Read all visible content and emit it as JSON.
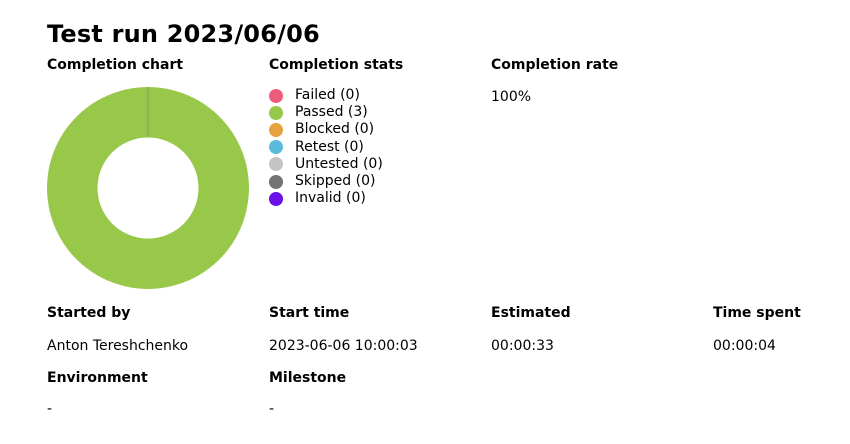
{
  "page": {
    "title": "Test run 2023/06/06"
  },
  "completion_chart": {
    "heading": "Completion chart"
  },
  "completion_stats": {
    "heading": "Completion stats",
    "items": [
      {
        "label": "Failed (0)",
        "color": "#ef5b7a",
        "count": 0
      },
      {
        "label": "Passed (3)",
        "color": "#98c84a",
        "count": 3
      },
      {
        "label": "Blocked (0)",
        "color": "#e6a23c",
        "count": 0
      },
      {
        "label": "Retest (0)",
        "color": "#5bbbdc",
        "count": 0
      },
      {
        "label": "Untested (0)",
        "color": "#c4c4c4",
        "count": 0
      },
      {
        "label": "Skipped (0)",
        "color": "#747474",
        "count": 0
      },
      {
        "label": "Invalid (0)",
        "color": "#6a10e8",
        "count": 0
      }
    ]
  },
  "completion_rate": {
    "heading": "Completion rate",
    "value": "100%"
  },
  "details": {
    "started_by": {
      "label": "Started by",
      "value": "Anton Tereshchenko"
    },
    "start_time": {
      "label": "Start time",
      "value": "2023-06-06 10:00:03"
    },
    "estimated": {
      "label": "Estimated",
      "value": "00:00:33"
    },
    "time_spent": {
      "label": "Time spent",
      "value": "00:00:04"
    },
    "environment": {
      "label": "Environment",
      "value": "-"
    },
    "milestone": {
      "label": "Milestone",
      "value": "-"
    }
  },
  "chart_data": {
    "type": "pie",
    "categories": [
      "Failed",
      "Passed",
      "Blocked",
      "Retest",
      "Untested",
      "Skipped",
      "Invalid"
    ],
    "values": [
      0,
      3,
      0,
      0,
      0,
      0,
      0
    ],
    "colors": [
      "#ef5b7a",
      "#98c84a",
      "#e6a23c",
      "#5bbbdc",
      "#c4c4c4",
      "#747474",
      "#6a10e8"
    ],
    "donut": true
  }
}
